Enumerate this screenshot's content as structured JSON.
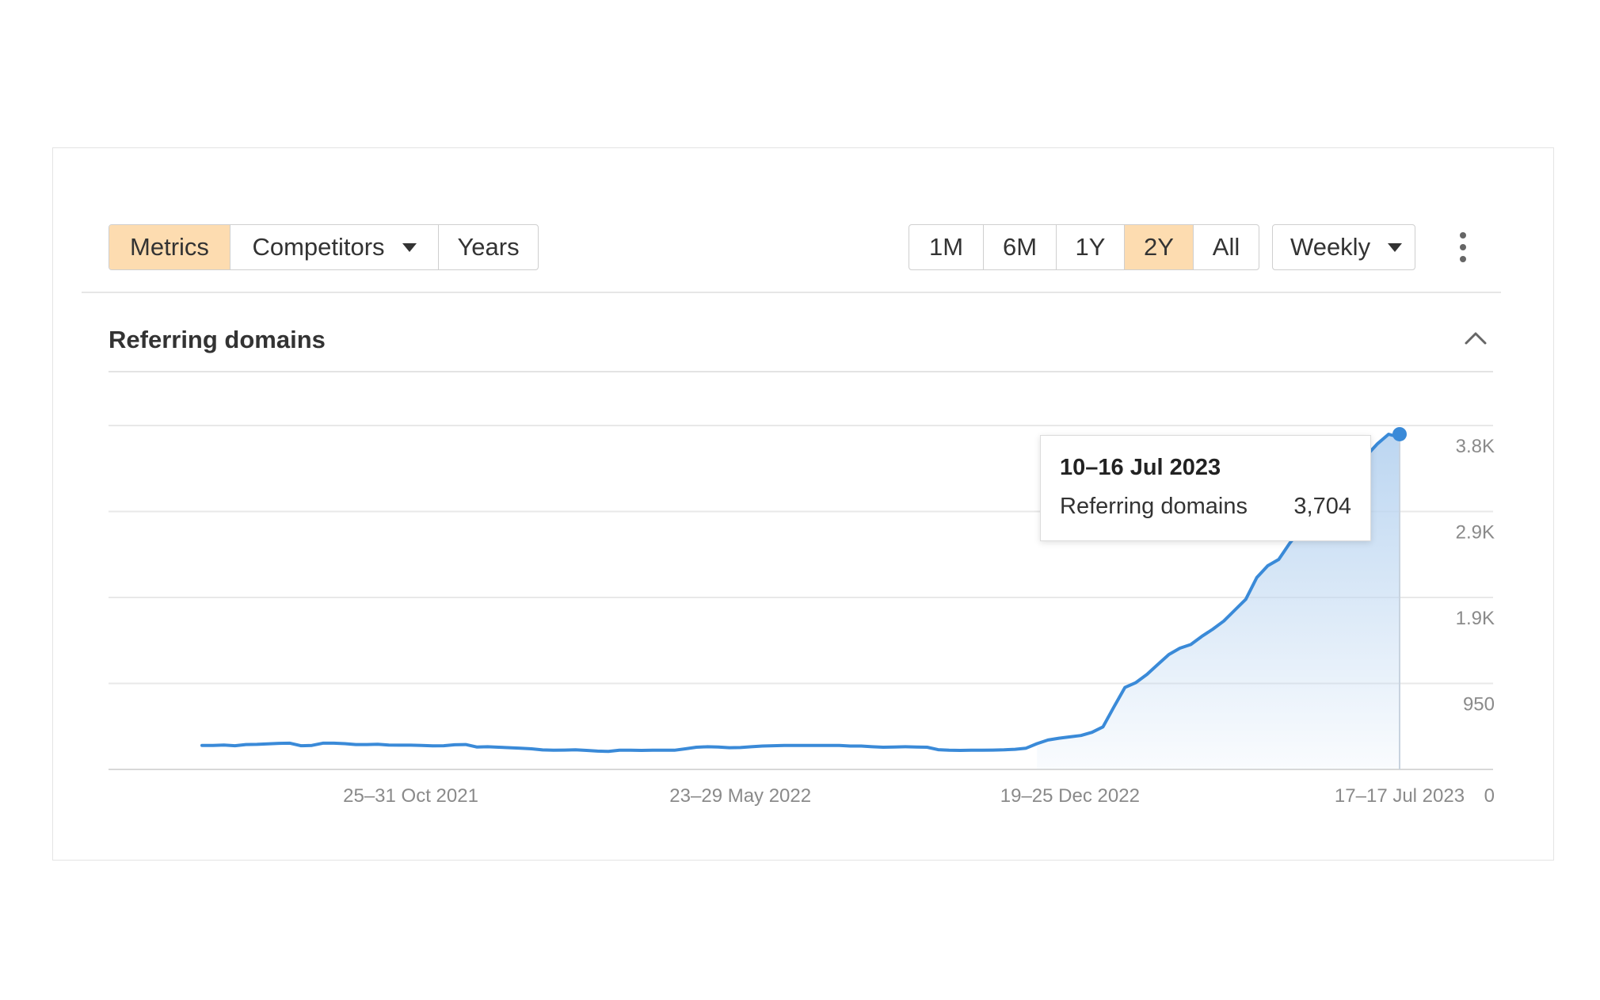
{
  "toolbar": {
    "tabs": [
      {
        "label": "Metrics",
        "active": true
      },
      {
        "label": "Competitors",
        "active": false
      },
      {
        "label": "Years",
        "active": false
      }
    ],
    "ranges": [
      {
        "label": "1M",
        "active": false
      },
      {
        "label": "6M",
        "active": false
      },
      {
        "label": "1Y",
        "active": false
      },
      {
        "label": "2Y",
        "active": true
      },
      {
        "label": "All",
        "active": false
      }
    ],
    "granularity": "Weekly",
    "more_icon": "kebab-vertical-icon"
  },
  "section": {
    "title": "Referring domains",
    "collapse_icon": "chevron-up-icon"
  },
  "tooltip": {
    "date": "10–16 Jul 2023",
    "metric": "Referring domains",
    "value": "3,704"
  },
  "colors": {
    "accent_active": "#fddcb0",
    "line": "#3a8ad8",
    "fill": "#bcd6f1"
  },
  "chart_data": {
    "type": "area",
    "title": "Referring domains",
    "y_ticks": [
      "0",
      "950",
      "1.9K",
      "2.9K",
      "3.8K"
    ],
    "y_tick_values": [
      0,
      950,
      1900,
      2850,
      3800
    ],
    "ylim": [
      0,
      3800
    ],
    "x_ticks": [
      {
        "label": "25–31 Oct 2021",
        "week": 19
      },
      {
        "label": "23–29 May 2022",
        "week": 49
      },
      {
        "label": "19–25 Dec 2022",
        "week": 79
      },
      {
        "label": "17–17 Jul 2023",
        "week": 109
      }
    ],
    "x_range_weeks": [
      0,
      109
    ],
    "grid": true,
    "highlight": {
      "week": 109,
      "value": 3704,
      "label": "10–16 Jul 2023"
    },
    "values": [
      265,
      265,
      270,
      262,
      275,
      277,
      282,
      288,
      290,
      262,
      265,
      290,
      290,
      285,
      275,
      275,
      278,
      270,
      268,
      268,
      265,
      260,
      262,
      272,
      275,
      248,
      250,
      245,
      240,
      235,
      228,
      215,
      212,
      214,
      216,
      210,
      202,
      200,
      212,
      212,
      210,
      212,
      212,
      212,
      228,
      245,
      250,
      248,
      240,
      242,
      250,
      258,
      262,
      265,
      265,
      265,
      265,
      265,
      265,
      258,
      258,
      250,
      245,
      248,
      250,
      248,
      245,
      218,
      212,
      210,
      212,
      212,
      214,
      216,
      222,
      235,
      285,
      325,
      345,
      360,
      375,
      410,
      470,
      690,
      905,
      960,
      1050,
      1160,
      1270,
      1340,
      1380,
      1470,
      1550,
      1640,
      1760,
      1880,
      2120,
      2250,
      2320,
      2500,
      2650,
      2820,
      3010,
      3120,
      3200,
      3300,
      3470,
      3600,
      3704,
      3670
    ]
  }
}
